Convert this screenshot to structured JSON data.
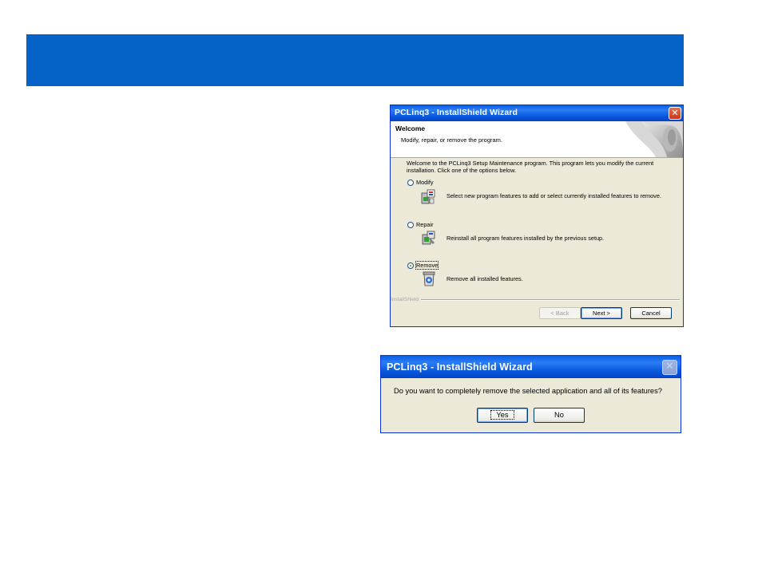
{
  "wizard": {
    "title": "PCLinq3 - InstallShield Wizard",
    "close_glyph": "✕",
    "header_title": "Welcome",
    "header_subtitle": "Modify, repair, or remove the program.",
    "intro": "Welcome to the PCLinq3 Setup Maintenance program. This program lets you modify the current installation. Click one of the options below.",
    "options": [
      {
        "label": "Modify",
        "description": "Select new program features to add or select currently installed features to remove.",
        "selected": false,
        "icon": "modify-icon"
      },
      {
        "label": "Repair",
        "description": "Reinstall all program features installed by the previous setup.",
        "selected": false,
        "icon": "repair-icon"
      },
      {
        "label": "Remove",
        "description": "Remove all installed features.",
        "selected": true,
        "icon": "remove-icon"
      }
    ],
    "brand": "InstallShield",
    "buttons": {
      "back": "< Back",
      "next": "Next >",
      "cancel": "Cancel"
    }
  },
  "confirm": {
    "title": "PCLinq3 - InstallShield Wizard",
    "close_glyph": "✕",
    "message": "Do you want to completely remove the selected application and all of its features?",
    "buttons": {
      "yes": "Yes",
      "no": "No"
    }
  },
  "colors": {
    "banner": "#0563c8",
    "titlebar": "#0a5fe8",
    "dialog_bg": "#ece9d8"
  }
}
